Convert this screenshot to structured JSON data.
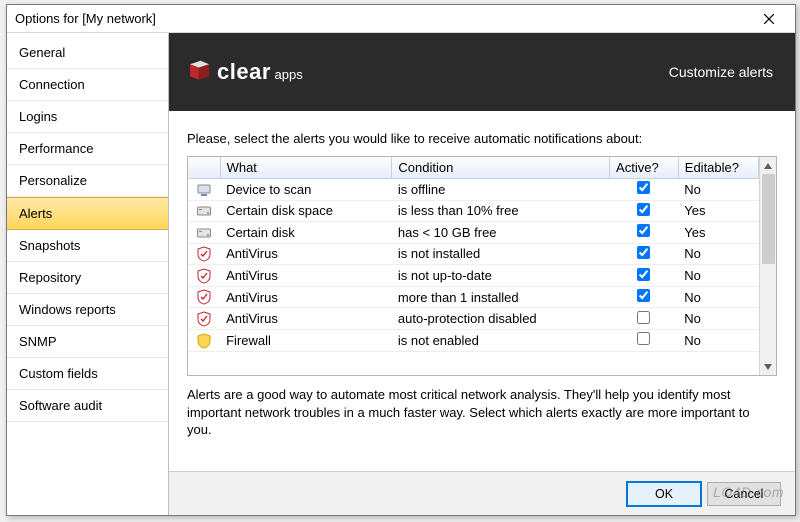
{
  "window": {
    "title": "Options for [My network]"
  },
  "sidebar": {
    "items": [
      {
        "label": "General"
      },
      {
        "label": "Connection"
      },
      {
        "label": "Logins"
      },
      {
        "label": "Performance"
      },
      {
        "label": "Personalize"
      },
      {
        "label": "Alerts",
        "selected": true
      },
      {
        "label": "Snapshots"
      },
      {
        "label": "Repository"
      },
      {
        "label": "Windows reports"
      },
      {
        "label": "SNMP"
      },
      {
        "label": "Custom fields"
      },
      {
        "label": "Software audit"
      }
    ]
  },
  "banner": {
    "brand": "clear",
    "brand_sub": "apps",
    "title": "Customize alerts"
  },
  "content": {
    "intro": "Please, select the alerts you would like to receive automatic notifications about:",
    "columns": {
      "what": "What",
      "condition": "Condition",
      "active": "Active?",
      "editable": "Editable?"
    },
    "rows": [
      {
        "icon": "device",
        "what": "Device to scan",
        "condition": "is offline",
        "active": true,
        "editable": "No"
      },
      {
        "icon": "disk",
        "what": "Certain disk space",
        "condition": "is less than 10% free",
        "active": true,
        "editable": "Yes"
      },
      {
        "icon": "disk",
        "what": "Certain disk",
        "condition": "has <  10 GB free",
        "active": true,
        "editable": "Yes"
      },
      {
        "icon": "av",
        "what": "AntiVirus",
        "condition": "is not installed",
        "active": true,
        "editable": "No"
      },
      {
        "icon": "av",
        "what": "AntiVirus",
        "condition": "is not up-to-date",
        "active": true,
        "editable": "No"
      },
      {
        "icon": "av",
        "what": "AntiVirus",
        "condition": "more than 1 installed",
        "active": true,
        "editable": "No"
      },
      {
        "icon": "av",
        "what": "AntiVirus",
        "condition": "auto-protection disabled",
        "active": false,
        "editable": "No"
      },
      {
        "icon": "firewall",
        "what": "Firewall",
        "condition": "is not enabled",
        "active": false,
        "editable": "No"
      }
    ],
    "description": "Alerts are a good way to automate most critical network analysis. They'll help you identify most important network troubles in a much faster way. Select which alerts exactly are more important to you."
  },
  "footer": {
    "ok": "OK",
    "cancel": "Cancel"
  },
  "watermark": "LO4D.com"
}
